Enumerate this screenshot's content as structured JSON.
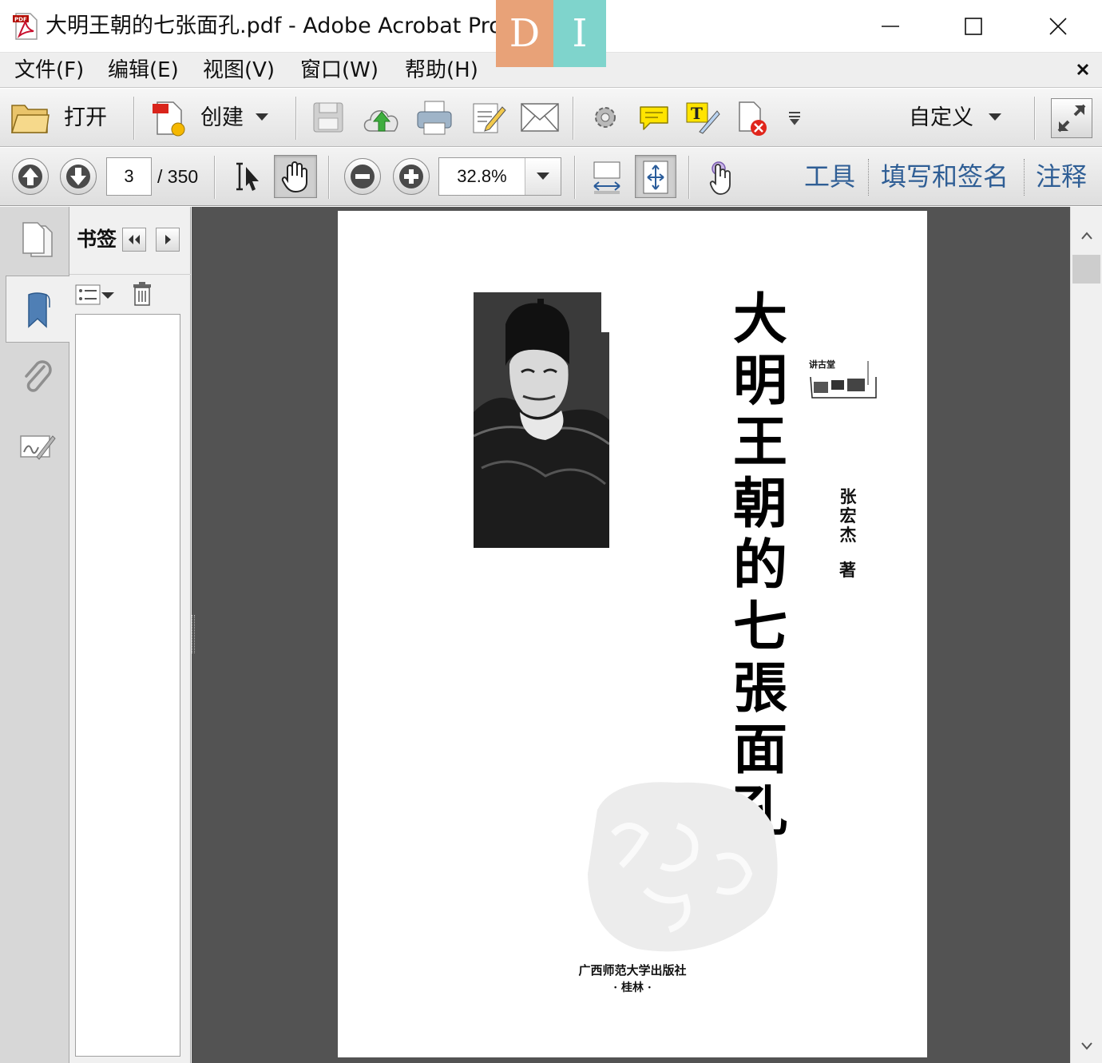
{
  "window": {
    "title": "大明王朝的七张面孔.pdf - Adobe Acrobat Pro",
    "overlay_logo": [
      "D",
      "I"
    ]
  },
  "menu": {
    "items": [
      "文件(F)",
      "编辑(E)",
      "视图(V)",
      "窗口(W)",
      "帮助(H)"
    ]
  },
  "toolbar": {
    "open_label": "打开",
    "create_label": "创建",
    "customize_label": "自定义"
  },
  "navigation": {
    "current_page": "3",
    "total_pages": "/ 350",
    "zoom": "32.8%"
  },
  "pane_links": {
    "tools": "工具",
    "fill_sign": "填写和签名",
    "comment": "注释"
  },
  "bookmarks": {
    "title": "书签"
  },
  "document_page": {
    "title_chars": [
      "大",
      "明",
      "王",
      "朝",
      "的",
      "七",
      "張",
      "面",
      "孔"
    ],
    "author_chars": [
      "张",
      "宏",
      "杰"
    ],
    "author_role": "著",
    "series": "讲古堂",
    "publisher": "广西师范大学出版社",
    "city": "· 桂林 ·"
  },
  "colors": {
    "pane_link": "#2f5e95",
    "doc_background": "#535353",
    "logo_d": "#e8a278",
    "logo_i": "#7fd4cc"
  }
}
